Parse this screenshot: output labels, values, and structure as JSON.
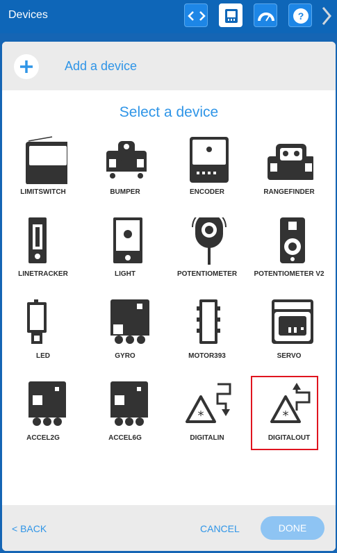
{
  "header": {
    "title": "Devices",
    "toolbar": [
      "code-icon",
      "devices-icon",
      "dashboard-icon",
      "help-icon"
    ],
    "colors": {
      "bar": "#0e66b8",
      "accent": "#2f95e7"
    }
  },
  "add_device": {
    "label": "Add a device"
  },
  "select": {
    "title": "Select a device"
  },
  "devices": [
    {
      "label": "LIMITSWITCH",
      "icon": "limitswitch-icon"
    },
    {
      "label": "BUMPER",
      "icon": "bumper-icon"
    },
    {
      "label": "ENCODER",
      "icon": "encoder-icon"
    },
    {
      "label": "RANGEFINDER",
      "icon": "rangefinder-icon"
    },
    {
      "label": "LINETRACKER",
      "icon": "linetracker-icon"
    },
    {
      "label": "LIGHT",
      "icon": "light-icon"
    },
    {
      "label": "POTENTIOMETER",
      "icon": "potentiometer-icon"
    },
    {
      "label": "POTENTIOMETER V2",
      "icon": "potentiometer-v2-icon"
    },
    {
      "label": "LED",
      "icon": "led-icon"
    },
    {
      "label": "GYRO",
      "icon": "gyro-icon"
    },
    {
      "label": "MOTOR393",
      "icon": "motor393-icon"
    },
    {
      "label": "SERVO",
      "icon": "servo-icon"
    },
    {
      "label": "ACCEL2G",
      "icon": "accel2g-icon"
    },
    {
      "label": "ACCEL6G",
      "icon": "accel6g-icon"
    },
    {
      "label": "DIGITALIN",
      "icon": "digitalin-icon"
    },
    {
      "label": "DIGITALOUT",
      "icon": "digitalout-icon",
      "selected": true
    }
  ],
  "footer": {
    "back": "< BACK",
    "cancel": "CANCEL",
    "done": "DONE"
  }
}
